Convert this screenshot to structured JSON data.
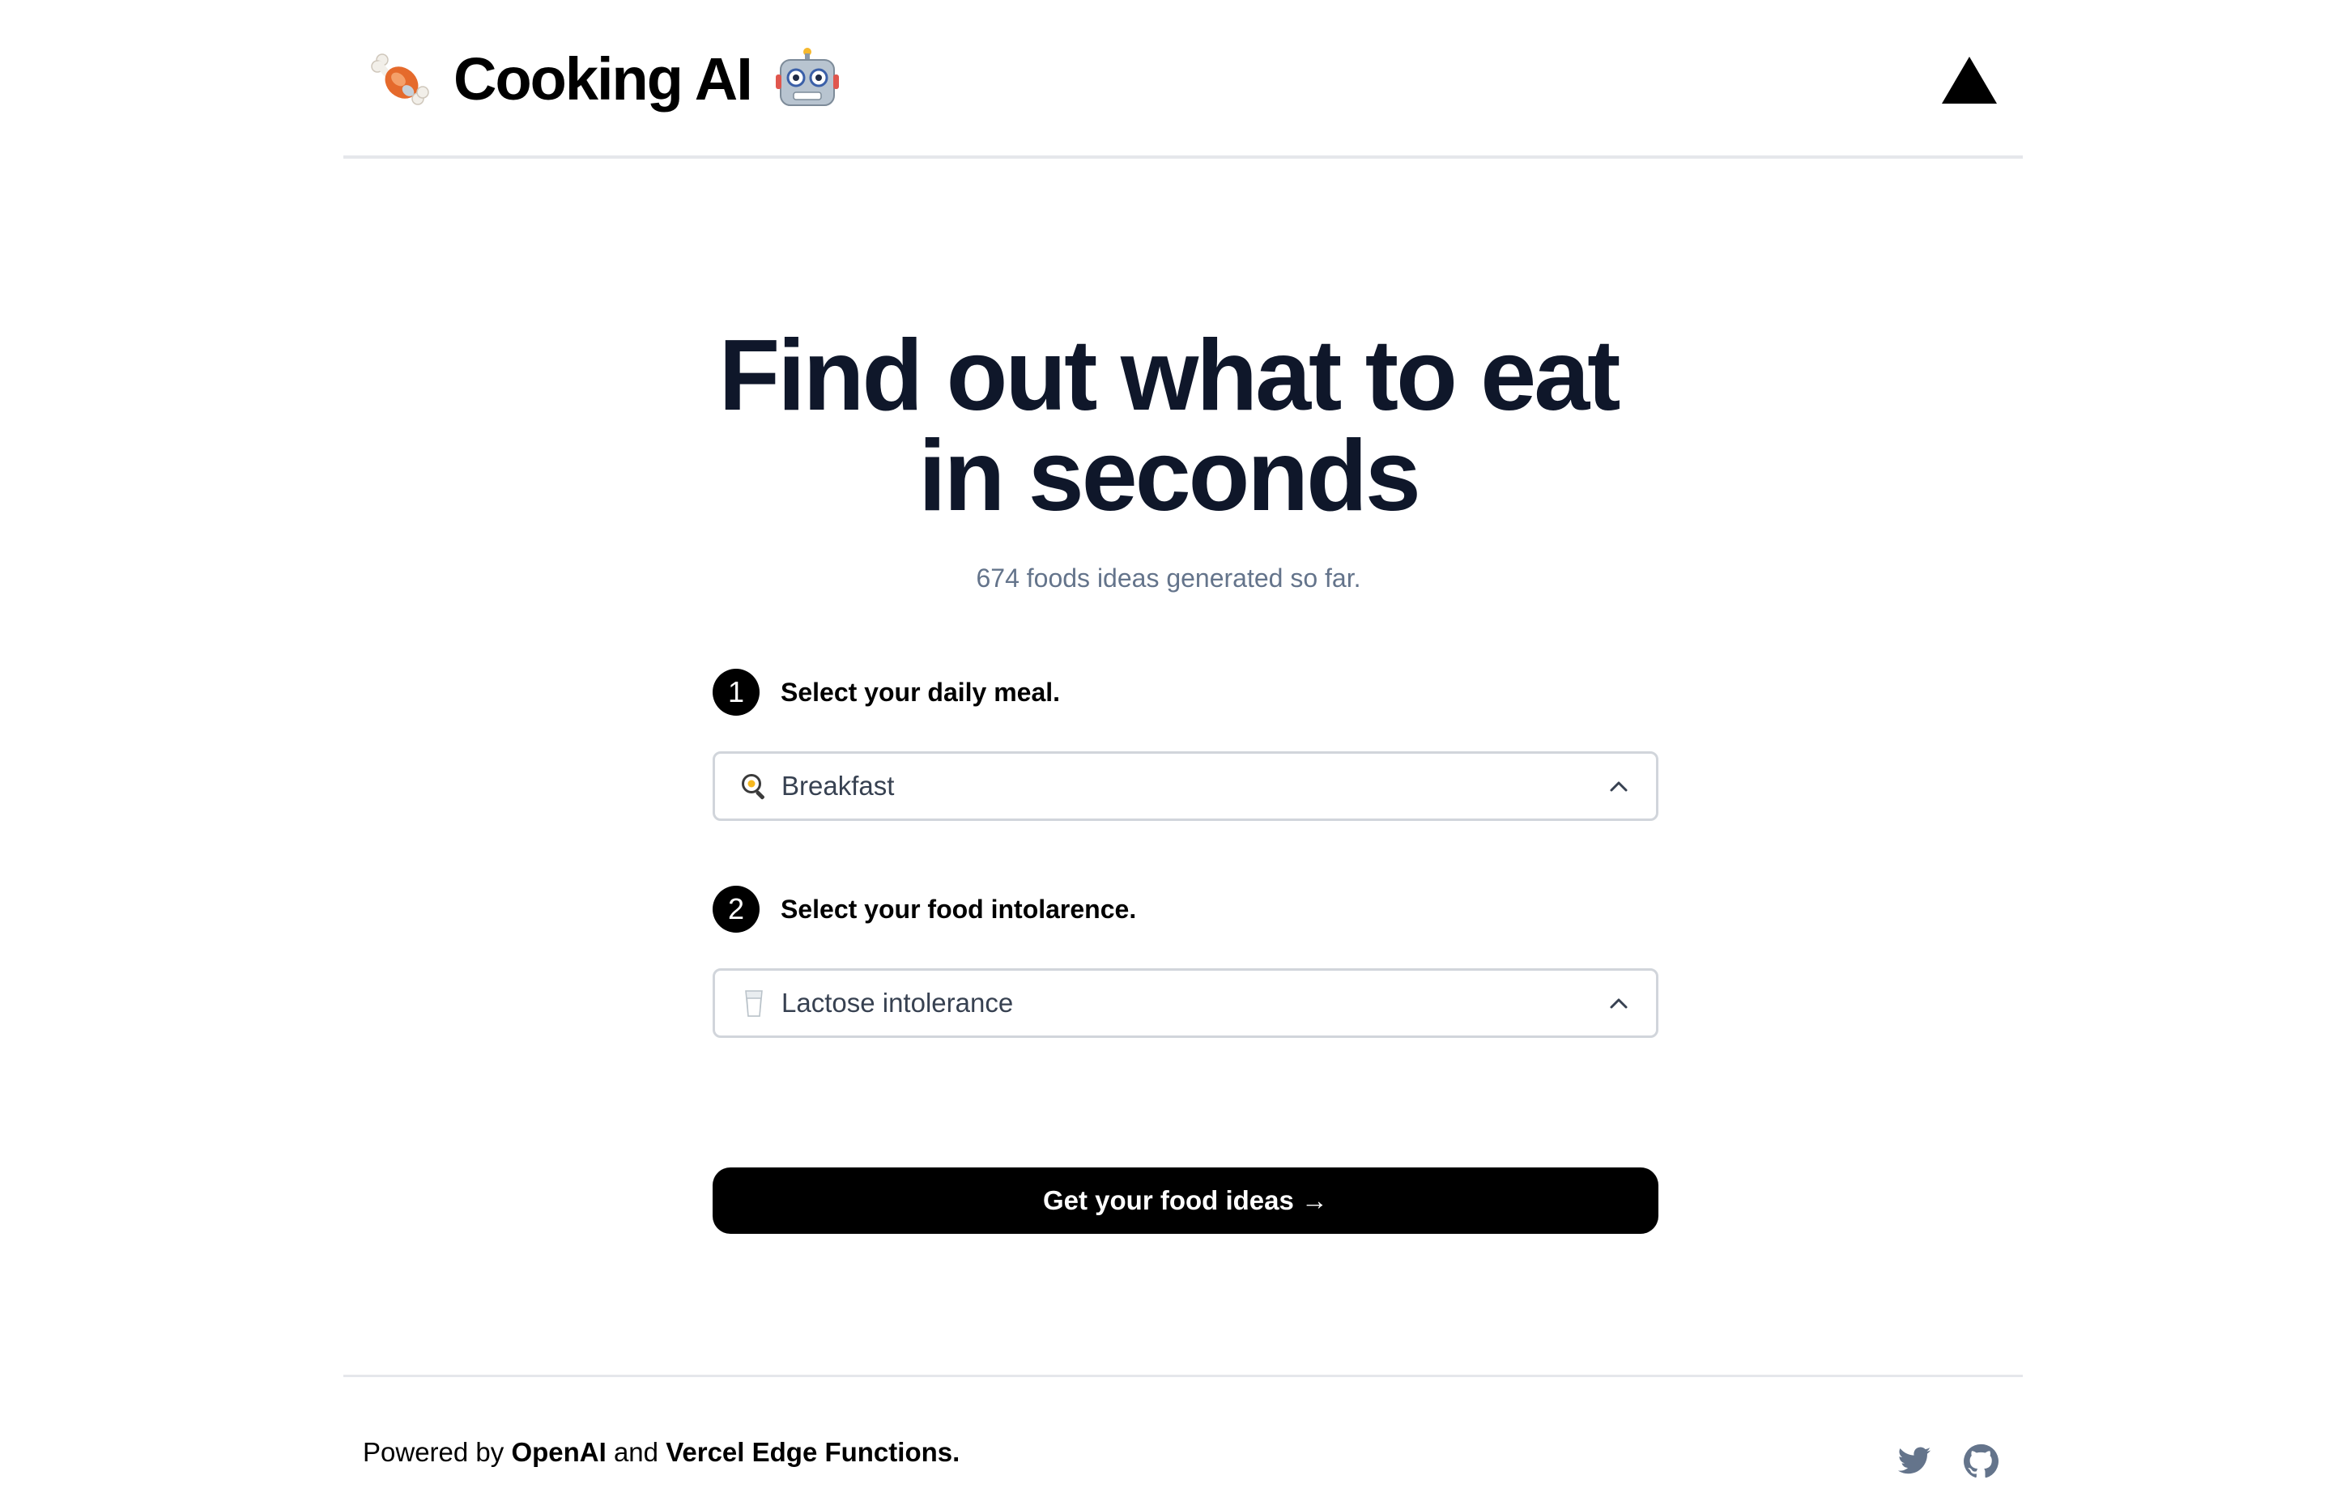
{
  "header": {
    "brand_emoji_left": "meat-on-bone",
    "title": "Cooking AI",
    "brand_emoji_right": "robot-face",
    "logo_icon": "vercel-triangle-icon"
  },
  "hero": {
    "title_line_1": "Find out what to eat",
    "title_line_2": "in seconds",
    "subtitle": "674 foods ideas generated so far."
  },
  "form": {
    "step1": {
      "number": "1",
      "label": "Select your daily meal.",
      "selected_value": "Breakfast",
      "selected_icon": "frying-pan-egg-icon"
    },
    "step2": {
      "number": "2",
      "label": "Select your food intolarence.",
      "selected_value": "Lactose intolerance",
      "selected_icon": "glass-of-milk-icon"
    },
    "submit_label": "Get your food ideas →"
  },
  "footer": {
    "prefix": "Powered by ",
    "link1": "OpenAI",
    "middle": " and ",
    "link2": "Vercel Edge Functions.",
    "icons": [
      "twitter-icon",
      "github-icon"
    ]
  },
  "colors": {
    "heading": "#0f172a",
    "muted": "#64748b",
    "border": "#d1d5db",
    "divider": "#e5e7eb",
    "button_bg": "#000000",
    "social_icon": "#64748b"
  }
}
